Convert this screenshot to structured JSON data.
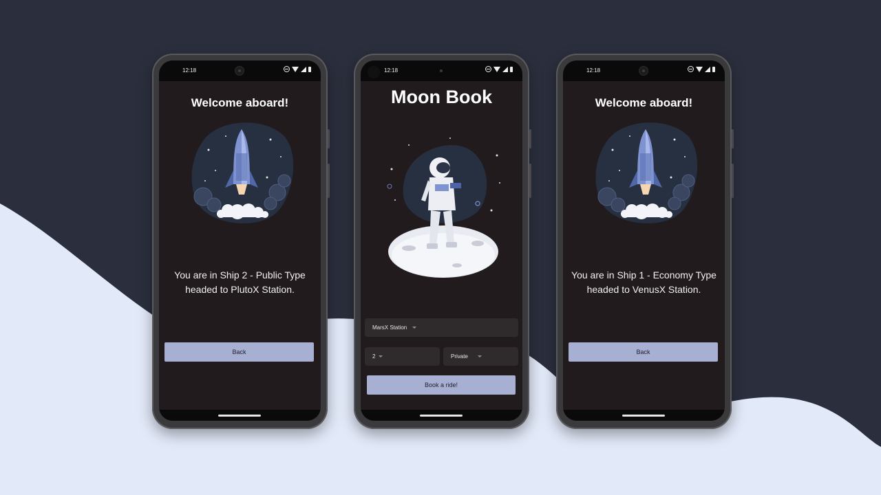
{
  "phones": [
    {
      "status_time": "12:18",
      "title": "Welcome aboard!",
      "message": "You are in Ship 2 - Public Type headed to PlutoX Station.",
      "button_label": "Back"
    },
    {
      "status_time": "12:18",
      "title": "Moon Book",
      "station_select": "MarsX Station",
      "count_select": "2",
      "type_select": "Private",
      "button_label": "Book a ride!"
    },
    {
      "status_time": "12:18",
      "title": "Welcome aboard!",
      "message": "You are in Ship 1 - Economy Type headed to VenusX Station.",
      "button_label": "Back"
    }
  ],
  "colors": {
    "background_dark": "#2b2f3d",
    "background_light": "#e2e9f8",
    "screen_bg": "#211b1d",
    "button_bg": "#a7afd3",
    "field_bg": "#2f2b2d"
  }
}
